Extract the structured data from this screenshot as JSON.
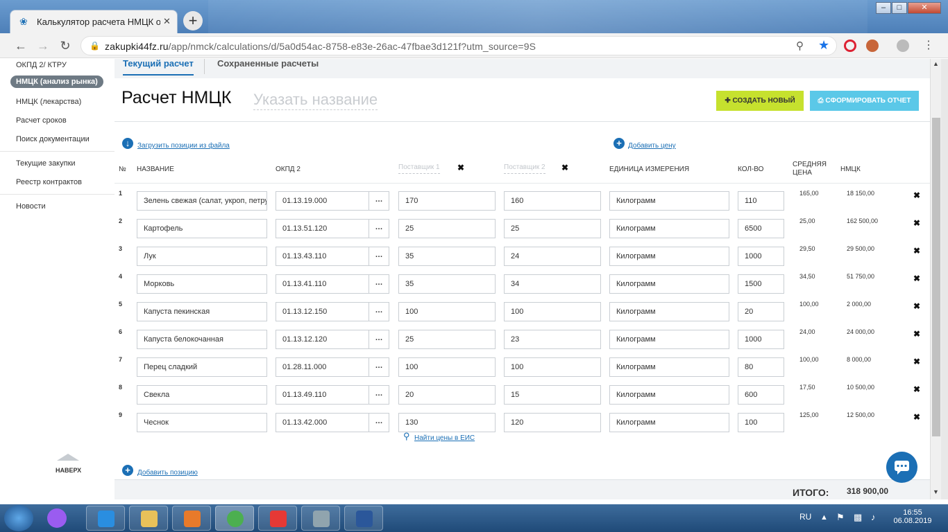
{
  "browser": {
    "tab_title": "Калькулятор расчета НМЦК он",
    "address_domain": "zakupki44fz.ru",
    "address_path": "/app/nmck/calculations/d/5a0d54ac-8758-e83e-26ac-47fbae3d121f?utm_source=9S"
  },
  "sidebar": {
    "items_top": [
      {
        "label": "ОКПД 2/ КТРУ"
      },
      {
        "label": "НМЦК (анализ рынка)"
      },
      {
        "label": "НМЦК (лекарства)"
      },
      {
        "label": "Расчет сроков"
      },
      {
        "label": "Поиск документации"
      }
    ],
    "items_mid": [
      {
        "label": "Текущие закупки"
      },
      {
        "label": "Реестр контрактов"
      }
    ],
    "items_bottom": [
      {
        "label": "Новости"
      }
    ],
    "scroll_top_label": "НАВЕРХ"
  },
  "page": {
    "tabs": [
      {
        "label": "Текущий расчет"
      },
      {
        "label": "Сохраненные расчеты"
      }
    ],
    "title": "Расчет НМЦК",
    "name_placeholder": "Указать название",
    "create_button": "СОЗДАТЬ НОВЫЙ",
    "report_button": "СФОРМИРОВАТЬ ОТЧЕТ",
    "load_link": "Загрузить позиции из файла",
    "add_price_link": "Добавить цену",
    "find_prices_link": "Найти цены в ЕИС",
    "add_position_link": "Добавить позицию",
    "total_label": "ИТОГО:",
    "total_value": "318 900,00"
  },
  "table": {
    "headers": {
      "no": "№",
      "name": "НАЗВАНИЕ",
      "okpd": "ОКПД 2",
      "sup1": "Поставщик 1",
      "sup2": "Поставщик 2",
      "unit": "ЕДИНИЦА ИЗМЕРЕНИЯ",
      "qty": "КОЛ-ВО",
      "avg1": "СРЕДНЯЯ",
      "avg2": "ЦЕНА",
      "nmck": "НМЦК"
    },
    "rows": [
      {
        "no": "1",
        "name": "Зелень свежая (салат, укроп, петрушка)",
        "okpd": "01.13.19.000",
        "p1": "170",
        "p2": "160",
        "unit": "Килограмм",
        "qty": "110",
        "avg": "165,00",
        "nmck": "18 150,00"
      },
      {
        "no": "2",
        "name": "Картофель",
        "okpd": "01.13.51.120",
        "p1": "25",
        "p2": "25",
        "unit": "Килограмм",
        "qty": "6500",
        "avg": "25,00",
        "nmck": "162 500,00"
      },
      {
        "no": "3",
        "name": "Лук",
        "okpd": "01.13.43.110",
        "p1": "35",
        "p2": "24",
        "unit": "Килограмм",
        "qty": "1000",
        "avg": "29,50",
        "nmck": "29 500,00"
      },
      {
        "no": "4",
        "name": "Морковь",
        "okpd": "01.13.41.110",
        "p1": "35",
        "p2": "34",
        "unit": "Килограмм",
        "qty": "1500",
        "avg": "34,50",
        "nmck": "51 750,00"
      },
      {
        "no": "5",
        "name": "Капуста пекинская",
        "okpd": "01.13.12.150",
        "p1": "100",
        "p2": "100",
        "unit": "Килограмм",
        "qty": "20",
        "avg": "100,00",
        "nmck": "2 000,00"
      },
      {
        "no": "6",
        "name": "Капуста белокочанная",
        "okpd": "01.13.12.120",
        "p1": "25",
        "p2": "23",
        "unit": "Килограмм",
        "qty": "1000",
        "avg": "24,00",
        "nmck": "24 000,00"
      },
      {
        "no": "7",
        "name": "Перец сладкий",
        "okpd": "01.28.11.000",
        "p1": "100",
        "p2": "100",
        "unit": "Килограмм",
        "qty": "80",
        "avg": "100,00",
        "nmck": "8 000,00"
      },
      {
        "no": "8",
        "name": "Свекла",
        "okpd": "01.13.49.110",
        "p1": "20",
        "p2": "15",
        "unit": "Килограмм",
        "qty": "600",
        "avg": "17,50",
        "nmck": "10 500,00"
      },
      {
        "no": "9",
        "name": "Чеснок",
        "okpd": "01.13.42.000",
        "p1": "130",
        "p2": "120",
        "unit": "Килограмм",
        "qty": "100",
        "avg": "125,00",
        "nmck": "12 500,00"
      }
    ]
  },
  "taskbar": {
    "lang": "RU",
    "time": "16:55",
    "date": "06.08.2019"
  }
}
